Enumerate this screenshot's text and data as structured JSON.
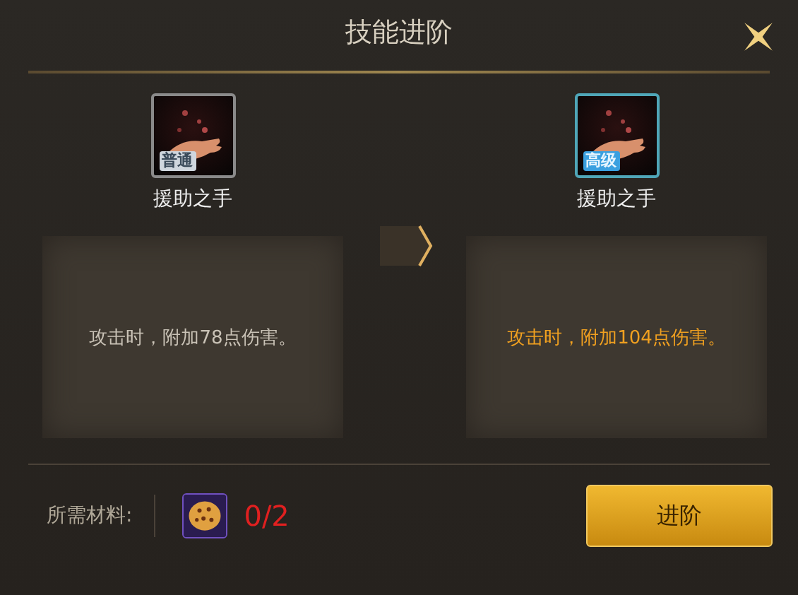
{
  "window": {
    "title": "技能进阶"
  },
  "skills": [
    {
      "name": "援助之手",
      "grade": "普通",
      "kind": "normal",
      "description": "攻击时，附加78点伤害。"
    },
    {
      "name": "援助之手",
      "grade": "高级",
      "kind": "advanced",
      "description": "攻击时，附加104点伤害。"
    }
  ],
  "materials": {
    "label": "所需材料:",
    "count": "0/2"
  },
  "buttons": [
    "进阶"
  ]
}
